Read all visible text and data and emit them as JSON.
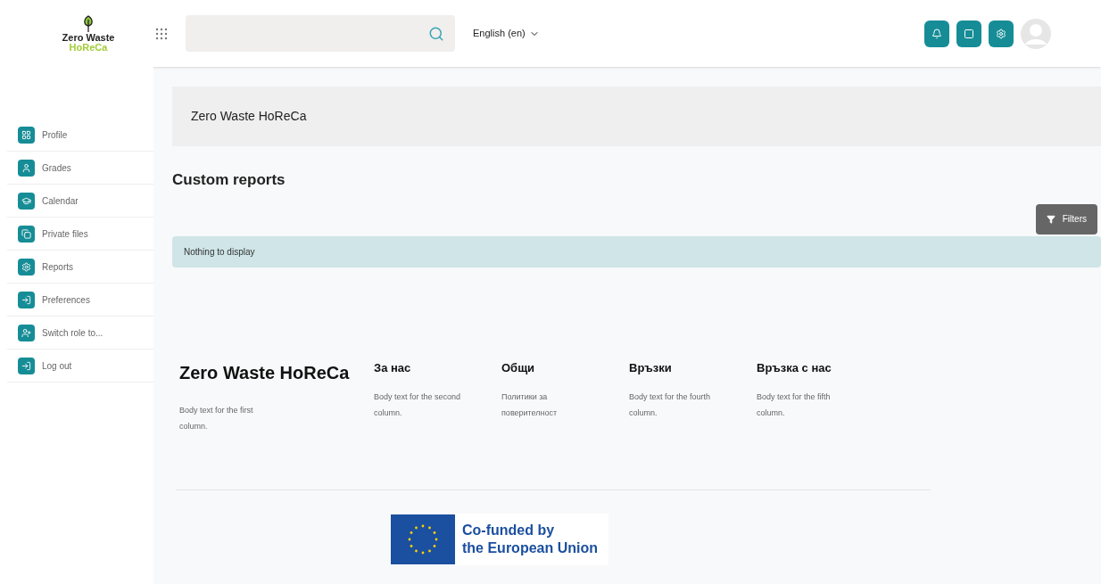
{
  "logo": {
    "line_1": "Zero Waste",
    "line_2": "HoReCa"
  },
  "header": {
    "language": "English (en)"
  },
  "sidebar": {
    "items": [
      {
        "label": "Profile"
      },
      {
        "label": "Grades"
      },
      {
        "label": "Calendar"
      },
      {
        "label": "Private files"
      },
      {
        "label": "Reports"
      },
      {
        "label": "Preferences"
      },
      {
        "label": "Switch role to..."
      },
      {
        "label": "Log out"
      }
    ]
  },
  "page_header": "Zero Waste HoReCa",
  "heading": "Custom reports",
  "filters_button": "Filters",
  "notice": "Nothing to display",
  "footer": {
    "columns": [
      {
        "title": "Zero Waste HoReCa",
        "text": "Body text for the first column."
      },
      {
        "title": "За нас",
        "text": "Body text for the second column."
      },
      {
        "title": "Общи",
        "text": "Политики за поверителност"
      },
      {
        "title": "Връзки",
        "text": "Body text for the fourth column."
      },
      {
        "title": "Връзка с нас",
        "text": "Body text for the fifth column."
      }
    ],
    "funding": {
      "line_1": "Co-funded by",
      "line_2": "the European Union"
    }
  }
}
